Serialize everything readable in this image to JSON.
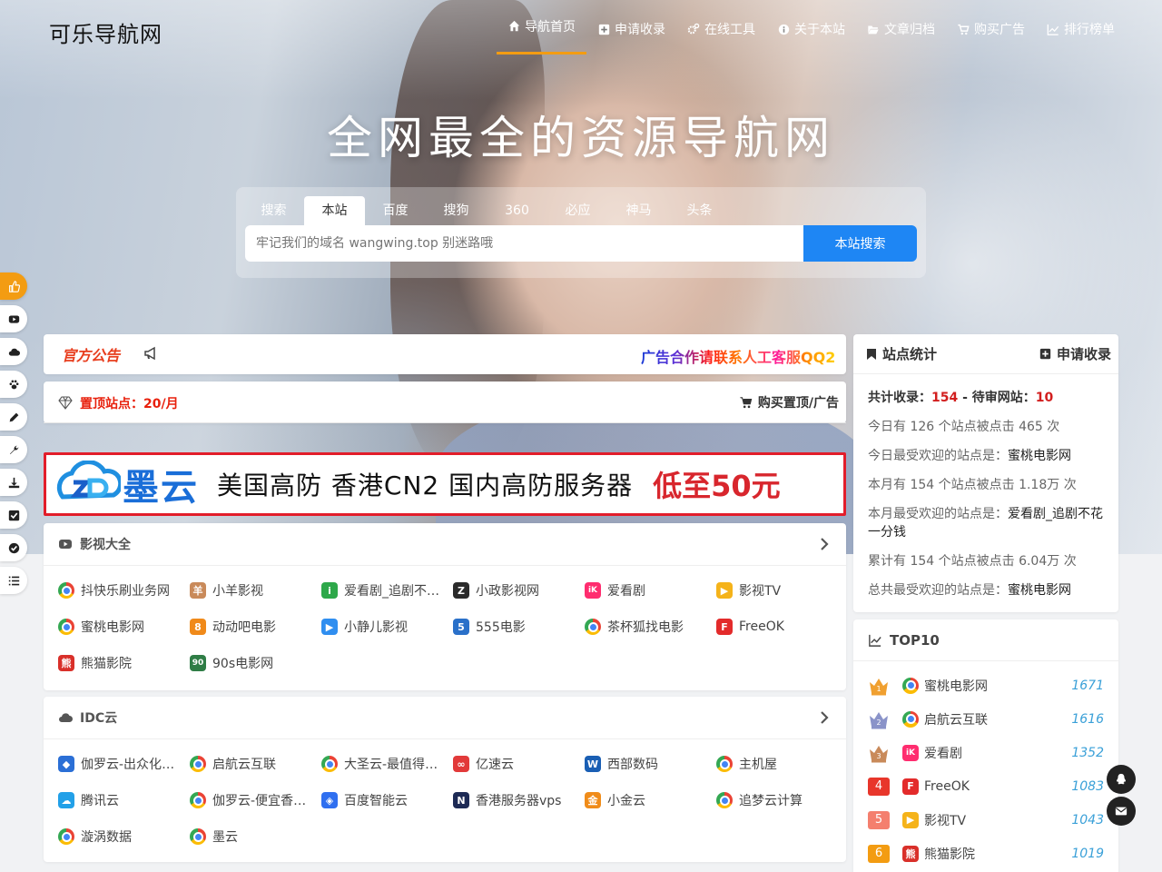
{
  "site": {
    "logo": "可乐导航网",
    "hero_title": "全网最全的资源导航网"
  },
  "nav": [
    {
      "label": "导航首页",
      "icon": "home-icon",
      "active": true
    },
    {
      "label": "申请收录",
      "icon": "plus-square-icon"
    },
    {
      "label": "在线工具",
      "icon": "cogs-icon"
    },
    {
      "label": "关于本站",
      "icon": "info-circle-icon"
    },
    {
      "label": "文章归档",
      "icon": "folder-open-icon"
    },
    {
      "label": "购买广告",
      "icon": "cart-icon"
    },
    {
      "label": "排行榜单",
      "icon": "line-chart-icon"
    }
  ],
  "search": {
    "tabs": [
      "搜索",
      "本站",
      "百度",
      "搜狗",
      "360",
      "必应",
      "神马",
      "头条"
    ],
    "active_tab": "本站",
    "placeholder": "牢记我们的域名 wangwing.top 别迷路哦",
    "button": "本站搜索"
  },
  "side_tools": [
    "thumbs-up-icon",
    "youtube-play-icon",
    "cloud-icon",
    "paw-icon",
    "pencil-icon",
    "wrench-icon",
    "download-icon",
    "check-square-icon",
    "check-circle-icon",
    "list-icon"
  ],
  "notice": {
    "title": "官方公告",
    "text": "广告合作请联系人工客服QQ2"
  },
  "pinned": {
    "title": "置顶站点：20/月",
    "buy": "购买置顶/广告"
  },
  "banner": {
    "brand": "墨云",
    "text": "美国高防  香港CN2  国内高防服务器",
    "price": "低至50元"
  },
  "categories": [
    {
      "title": "影视大全",
      "icon": "youtube-play-icon",
      "sites": [
        {
          "name": "抖快乐刷业务网",
          "fav": "chrome"
        },
        {
          "name": "小羊影视",
          "fav": "sheep",
          "color": "#c98a5a"
        },
        {
          "name": "爱看剧_追剧不花一分钱",
          "fav": "i",
          "color": "#2ea84a"
        },
        {
          "name": "小政影视网",
          "fav": "Z",
          "color": "#2b2b2b"
        },
        {
          "name": "爱看剧",
          "fav": "iK",
          "color": "#ff2d6f"
        },
        {
          "name": "影视TV",
          "fav": "▶",
          "color": "#f5b31a"
        },
        {
          "name": "蜜桃电影网",
          "fav": "chrome"
        },
        {
          "name": "动动吧电影",
          "fav": "8",
          "color": "#f08a1a"
        },
        {
          "name": "小静儿影视",
          "fav": "▶",
          "color": "#2f8ef0"
        },
        {
          "name": "555电影",
          "fav": "5",
          "color": "#2a70c9"
        },
        {
          "name": "茶杯狐找电影",
          "fav": "chrome"
        },
        {
          "name": "FreeOK",
          "fav": "F",
          "color": "#e32b2b"
        },
        {
          "name": "熊猫影院",
          "fav": "熊",
          "color": "#d9302a"
        },
        {
          "name": "90s电影网",
          "fav": "90",
          "color": "#2f7d46"
        }
      ]
    },
    {
      "title": "IDC云",
      "icon": "cloud-icon",
      "sites": [
        {
          "name": "伽罗云-出众化的云服务",
          "fav": "◆",
          "color": "#2b6fd6"
        },
        {
          "name": "启航云互联",
          "fav": "chrome"
        },
        {
          "name": "大圣云-最值得信赖的云",
          "fav": "chrome"
        },
        {
          "name": "亿速云",
          "fav": "∞",
          "color": "#e23a3a"
        },
        {
          "name": "西部数码",
          "fav": "W",
          "color": "#1a5fb4"
        },
        {
          "name": "主机屋",
          "fav": "chrome"
        },
        {
          "name": "腾讯云",
          "fav": "☁",
          "color": "#22a0e8"
        },
        {
          "name": "伽罗云-便宜香港服务器",
          "fav": "chrome"
        },
        {
          "name": "百度智能云",
          "fav": "◈",
          "color": "#2f6ff0"
        },
        {
          "name": "香港服务器vps",
          "fav": "N",
          "color": "#1d2a55"
        },
        {
          "name": "小金云",
          "fav": "金",
          "color": "#f08c1a"
        },
        {
          "name": "追梦云计算",
          "fav": "chrome"
        },
        {
          "name": "漩涡数据",
          "fav": "chrome"
        },
        {
          "name": "墨云",
          "fav": "chrome"
        }
      ]
    }
  ],
  "stats": {
    "title": "站点统计",
    "apply": "申请收录",
    "total_label": "共计收录：",
    "total": "154",
    "sep": " - ",
    "pending_label": "待审网站：",
    "pending": "10",
    "lines": [
      {
        "pre": "今日有 126 个站点被点击 465 次"
      },
      {
        "pre": "今日最受欢迎的站点是：",
        "val": "蜜桃电影网"
      },
      {
        "pre": "本月有 154 个站点被点击 1.18万 次"
      },
      {
        "pre": "本月最受欢迎的站点是：",
        "val": "爱看剧_追剧不花一分钱"
      },
      {
        "pre": "累计有 154 个站点被点击 6.04万 次"
      },
      {
        "pre": "总共最受欢迎的站点是：",
        "val": "蜜桃电影网"
      }
    ]
  },
  "top10": {
    "title": "TOP10",
    "items": [
      {
        "rank": "1",
        "name": "蜜桃电影网",
        "count": "1671",
        "fav": "chrome",
        "medal": "#f0a030"
      },
      {
        "rank": "2",
        "name": "启航云互联",
        "count": "1616",
        "fav": "chrome",
        "medal": "#8a93c9"
      },
      {
        "rank": "3",
        "name": "爱看剧",
        "count": "1352",
        "fav": "iK",
        "favcolor": "#ff2d6f",
        "medal": "#c98a5a"
      },
      {
        "rank": "4",
        "name": "FreeOK",
        "count": "1083",
        "fav": "F",
        "favcolor": "#e32b2b",
        "badge": "#e8362b"
      },
      {
        "rank": "5",
        "name": "影视TV",
        "count": "1043",
        "fav": "▶",
        "favcolor": "#f5b31a",
        "badge": "#f47f6e"
      },
      {
        "rank": "6",
        "name": "熊猫影院",
        "count": "1019",
        "fav": "熊",
        "favcolor": "#d9302a",
        "badge": "#f39c12"
      }
    ]
  },
  "float_buttons": [
    "qq-icon",
    "mail-icon"
  ]
}
